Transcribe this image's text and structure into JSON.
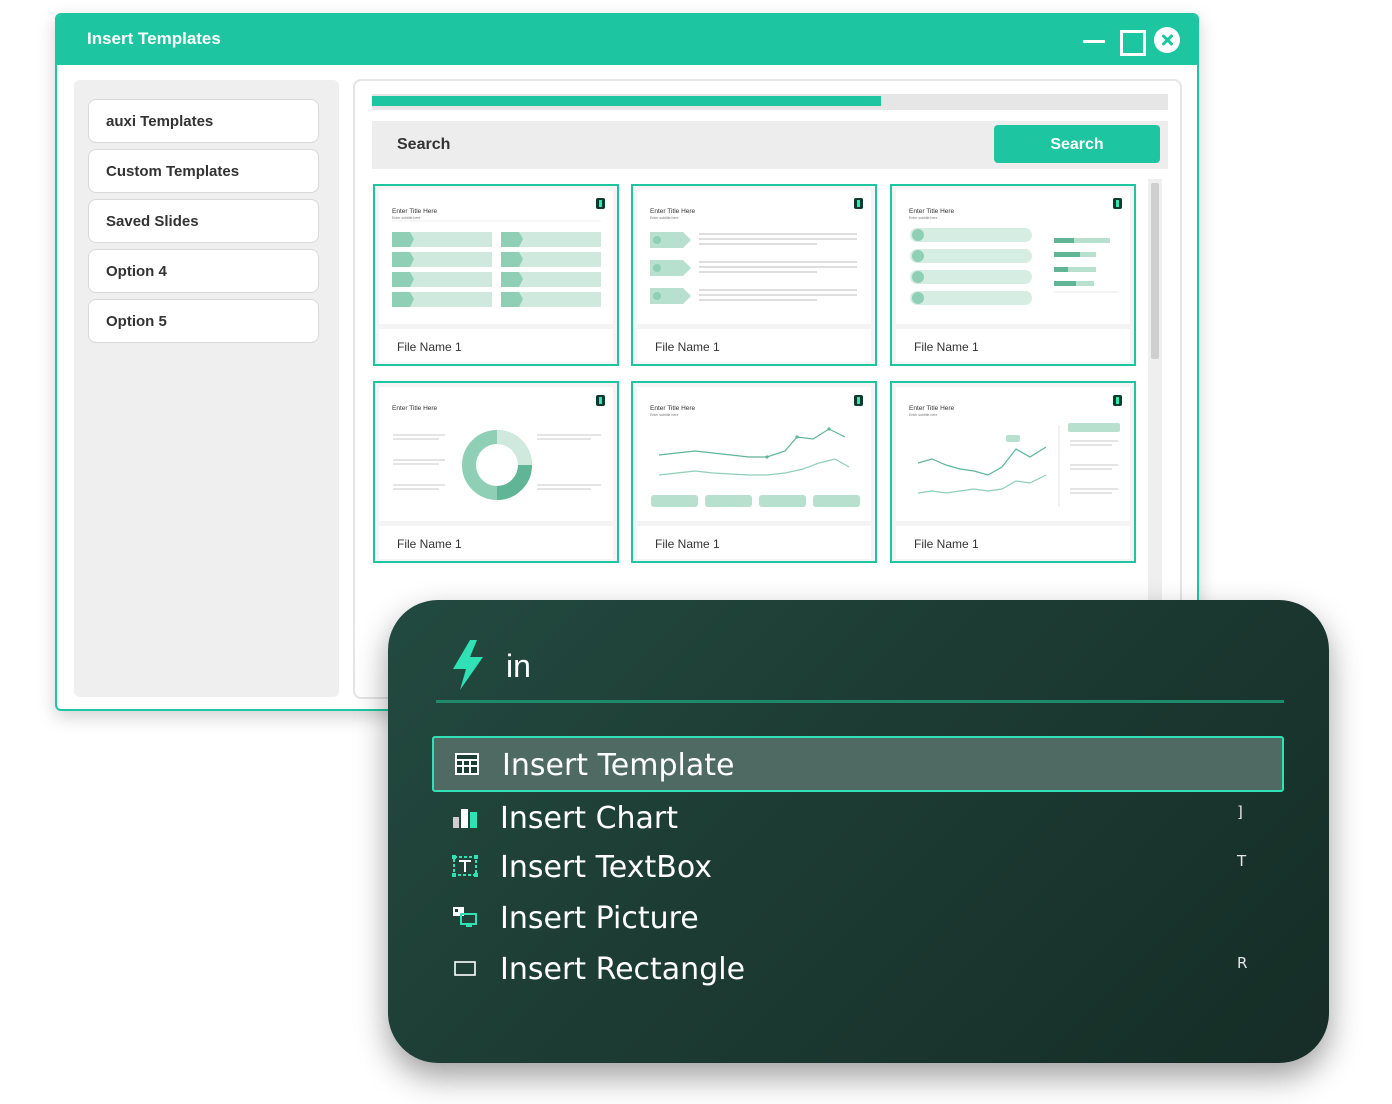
{
  "window": {
    "title": "Insert Templates",
    "controls": {
      "minimize_icon": "minimize-icon",
      "maximize_icon": "maximize-icon",
      "close_icon": "close-icon"
    }
  },
  "sidebar": {
    "items": [
      {
        "label": "auxi Templates"
      },
      {
        "label": "Custom Templates"
      },
      {
        "label": "Saved Slides"
      },
      {
        "label": "Option 4"
      },
      {
        "label": "Option 5"
      }
    ]
  },
  "content": {
    "progress_percent": 64,
    "search": {
      "placeholder": "Search",
      "button_label": "Search"
    },
    "cards": [
      {
        "file_name": "File Name 1",
        "slide_title": "Enter Title Here",
        "slide_subtitle": "Enter subtitle here",
        "preview": "process-list"
      },
      {
        "file_name": "File Name 1",
        "slide_title": "Enter Title Here",
        "slide_subtitle": "Enter subtitle here",
        "preview": "arrow-steps"
      },
      {
        "file_name": "File Name 1",
        "slide_title": "Enter Title Here",
        "slide_subtitle": "Enter subtitle here",
        "preview": "categories-bar-chart"
      },
      {
        "file_name": "File Name 1",
        "slide_title": "Enter Title Here",
        "slide_subtitle": "",
        "preview": "donut-chart"
      },
      {
        "file_name": "File Name 1",
        "slide_title": "Enter Title Here",
        "slide_subtitle": "Enter subtitle here",
        "preview": "line-chart-kpis"
      },
      {
        "file_name": "File Name 1",
        "slide_title": "Enter Title Here",
        "slide_subtitle": "Enter subtitle here",
        "preview": "line-chart-notes"
      }
    ]
  },
  "palette": {
    "query": "in",
    "brand_icon": "lightning-bolt-icon",
    "accent_color": "#2fe1b5",
    "items": [
      {
        "label": "Insert Template",
        "shortcut": "",
        "icon": "template-icon",
        "selected": true
      },
      {
        "label": "Insert Chart",
        "shortcut": "]",
        "icon": "bar-chart-icon",
        "selected": false
      },
      {
        "label": "Insert TextBox",
        "shortcut": "T",
        "icon": "textbox-icon",
        "selected": false
      },
      {
        "label": "Insert Picture",
        "shortcut": "",
        "icon": "picture-icon",
        "selected": false
      },
      {
        "label": "Insert Rectangle",
        "shortcut": "R",
        "icon": "rectangle-icon",
        "selected": false
      }
    ]
  },
  "colors": {
    "brand_teal": "#1dc6a1",
    "palette_bg": "#1d3d34",
    "selected_row": "#4e6a62"
  }
}
